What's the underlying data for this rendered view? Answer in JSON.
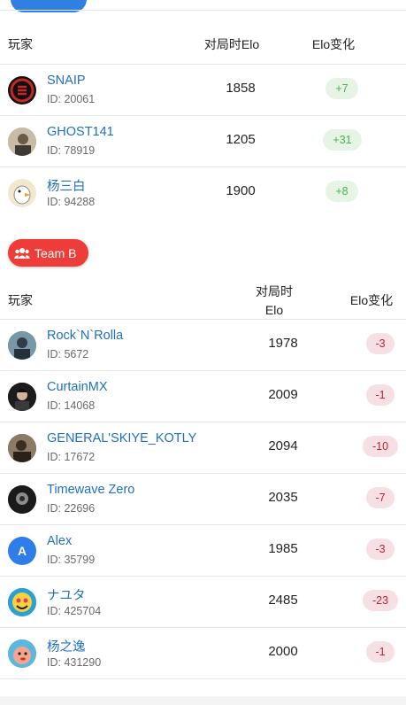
{
  "teamA": {
    "header": {
      "player": "玩家",
      "elo": "对局时Elo",
      "change": "Elo变化"
    },
    "players": [
      {
        "name": "SNAIP",
        "id": "ID: 20061",
        "elo": "1858",
        "change": "+7",
        "avatar": "snaip-logo-avatar",
        "color": "#b81d1d"
      },
      {
        "name": "GHOST141",
        "id": "ID: 78919",
        "elo": "1205",
        "change": "+31",
        "avatar": "photo-avatar",
        "color": "#9a8a72"
      },
      {
        "name": "杨三白",
        "id": "ID: 94288",
        "elo": "1900",
        "change": "+8",
        "avatar": "goose-avatar",
        "color": "#f1e8cf"
      }
    ]
  },
  "teamB": {
    "label": "Team B",
    "icon": "group-icon",
    "color": "#ee3c38",
    "header": {
      "player": "玩家",
      "elo_line1": "对局时",
      "elo_line2": "Elo",
      "change": "Elo变化"
    },
    "players": [
      {
        "name": "Rock`N`Rolla",
        "id": "ID: 5672",
        "elo": "1978",
        "change": "-3",
        "avatar": "photo-avatar",
        "color": "#4c6f82"
      },
      {
        "name": "CurtainMX",
        "id": "ID: 14068",
        "elo": "2009",
        "change": "-1",
        "avatar": "photo-avatar",
        "color": "#2a2a2a"
      },
      {
        "name": "GENERAL'SKIYE_KOTLY",
        "id": "ID: 17672",
        "elo": "2094",
        "change": "-10",
        "avatar": "photo-avatar",
        "color": "#5a4a3a"
      },
      {
        "name": "Timewave Zero",
        "id": "ID: 22696",
        "elo": "2035",
        "change": "-7",
        "avatar": "photo-avatar",
        "color": "#3a3a3a"
      },
      {
        "name": "Alex",
        "id": "ID: 35799",
        "elo": "1985",
        "change": "-3",
        "avatar": "letter-avatar",
        "letter": "A",
        "color": "#2f7de8"
      },
      {
        "name": "ナユタ",
        "id": "ID: 425704",
        "elo": "2485",
        "change": "-23",
        "avatar": "colorful-avatar",
        "color": "#2b9fd6"
      },
      {
        "name": "杨之逸",
        "id": "ID: 431290",
        "elo": "2000",
        "change": "-1",
        "avatar": "cartoon-avatar",
        "color": "#e77f6a"
      }
    ]
  },
  "colors": {
    "link": "#1f6fc2",
    "positive_bg": "#e6f4e6",
    "positive_fg": "#4caf50",
    "negative_bg": "#f7e0e3",
    "negative_fg": "#b3263a",
    "team_a_accent": "#2f80e0"
  }
}
